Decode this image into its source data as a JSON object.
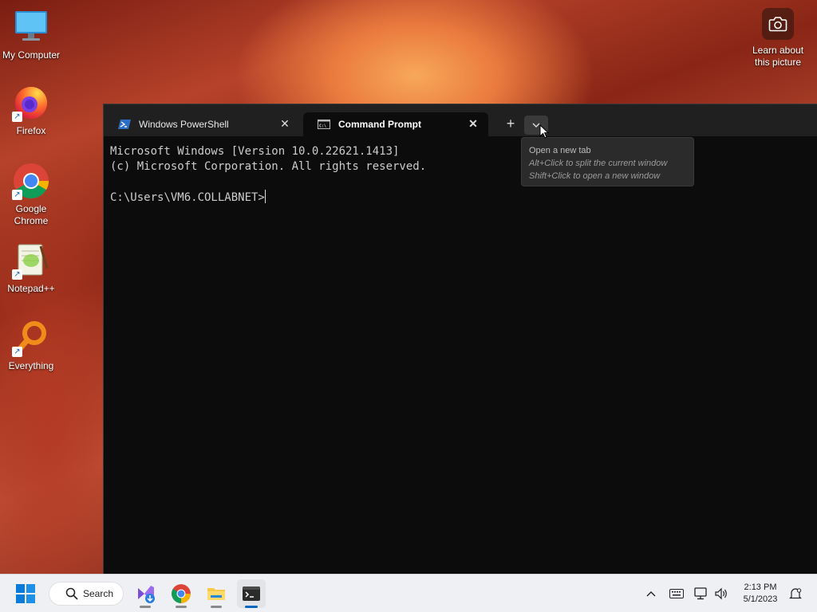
{
  "desktop": {
    "icons": [
      {
        "label": "My Computer"
      },
      {
        "label": "Firefox"
      },
      {
        "label": "Google Chrome"
      },
      {
        "label": "Notepad++"
      },
      {
        "label": "Everything"
      }
    ],
    "learn_picture": "Learn about this picture"
  },
  "terminal": {
    "tabs": [
      {
        "label": "Windows PowerShell",
        "active": false
      },
      {
        "label": "Command Prompt",
        "active": true
      }
    ],
    "console_lines": [
      "Microsoft Windows [Version 10.0.22621.1413]",
      "(c) Microsoft Corporation. All rights reserved.",
      "",
      "C:\\Users\\VM6.COLLABNET>"
    ],
    "tooltip": {
      "title": "Open a new tab",
      "line1": "Alt+Click to split the current window",
      "line2": "Shift+Click to open a new window"
    }
  },
  "taskbar": {
    "search_label": "Search",
    "clock_time": "2:13 PM",
    "clock_date": "5/1/2023",
    "accent": "#0067c0"
  }
}
